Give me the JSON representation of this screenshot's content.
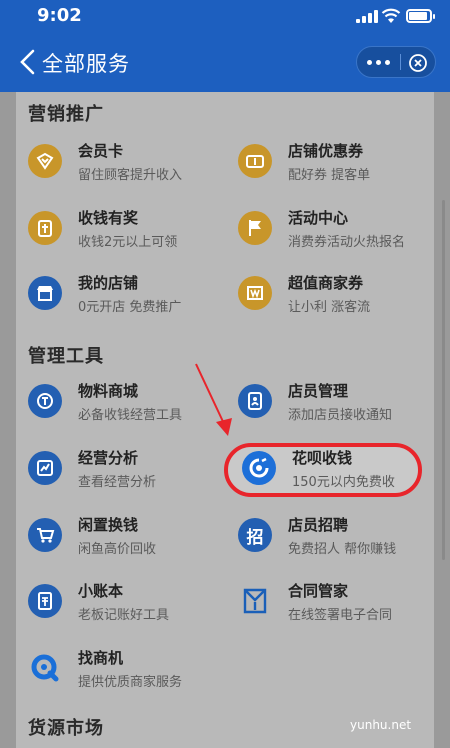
{
  "status": {
    "time": "9:02"
  },
  "nav": {
    "title": "全部服务"
  },
  "sections": [
    {
      "title": "营销推广",
      "items": [
        {
          "name": "会员卡",
          "desc": "留住顾客提升收入",
          "icon": "member-card-icon",
          "color": "orange"
        },
        {
          "name": "店铺优惠券",
          "desc": "配好券 提客单",
          "icon": "coupon-icon",
          "color": "orange"
        },
        {
          "name": "收钱有奖",
          "desc": "收钱2元以上可领",
          "icon": "gift-icon",
          "color": "orange"
        },
        {
          "name": "活动中心",
          "desc": "消费券活动火热报名",
          "icon": "flag-icon",
          "color": "orange"
        },
        {
          "name": "我的店铺",
          "desc": "0元开店 免费推广",
          "icon": "shop-icon",
          "color": "blue"
        },
        {
          "name": "超值商家券",
          "desc": "让小利 涨客流",
          "icon": "merchant-coupon-icon",
          "color": "orange"
        }
      ]
    },
    {
      "title": "管理工具",
      "items": [
        {
          "name": "物料商城",
          "desc": "必备收钱经营工具",
          "icon": "material-mall-icon",
          "color": "blue"
        },
        {
          "name": "店员管理",
          "desc": "添加店员接收通知",
          "icon": "staff-icon",
          "color": "blue"
        },
        {
          "name": "经营分析",
          "desc": "查看经营分析",
          "icon": "analysis-icon",
          "color": "blue"
        },
        {
          "name": "花呗收钱",
          "desc": "150元以内免费收",
          "icon": "huabei-icon",
          "color": "white"
        },
        {
          "name": "闲置换钱",
          "desc": "闲鱼高价回收",
          "icon": "idle-cart-icon",
          "color": "blue"
        },
        {
          "name": "店员招聘",
          "desc": "免费招人 帮你赚钱",
          "icon": "recruit-icon",
          "color": "blue"
        },
        {
          "name": "小账本",
          "desc": "老板记账好工具",
          "icon": "ledger-icon",
          "color": "blue"
        },
        {
          "name": "合同管家",
          "desc": "在线签署电子合同",
          "icon": "contract-icon",
          "color": "white"
        },
        {
          "name": "找商机",
          "desc": "提供优质商家服务",
          "icon": "opportunity-icon",
          "color": "white"
        }
      ]
    },
    {
      "title": "货源市场",
      "items": []
    }
  ],
  "icon_glyphs": {
    "recruit": "招"
  },
  "watermark": "yunhu.net",
  "colors": {
    "header": "#1d5fbf",
    "highlight": "#e8252b",
    "orange": "#c8962a",
    "blue": "#235fb2"
  }
}
